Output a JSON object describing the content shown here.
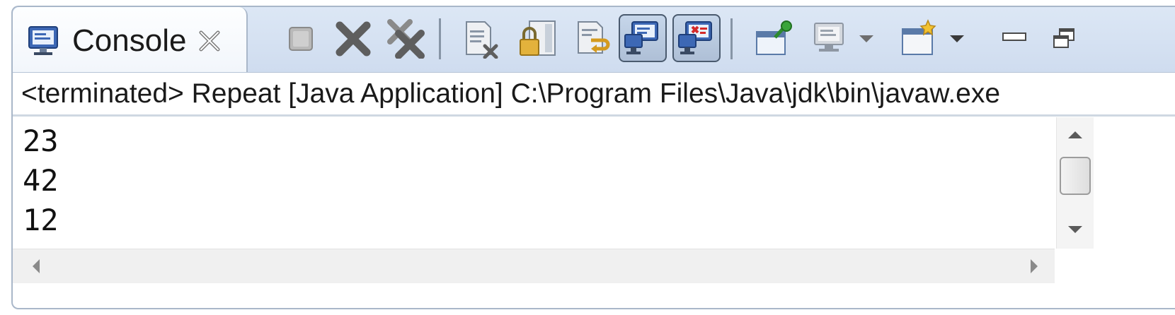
{
  "tab": {
    "label": "Console",
    "icon": "console-monitor-icon",
    "close_icon": "close-icon"
  },
  "toolbar": {
    "items": [
      {
        "name": "terminate",
        "icon": "terminate-stop-icon"
      },
      {
        "name": "remove-launch",
        "icon": "remove-launch-icon"
      },
      {
        "name": "remove-all-terminated",
        "icon": "remove-all-icon"
      },
      {
        "name": "clear-console",
        "icon": "clear-console-icon"
      },
      {
        "name": "scroll-lock",
        "icon": "scroll-lock-icon"
      },
      {
        "name": "word-wrap",
        "icon": "word-wrap-icon"
      },
      {
        "name": "show-on-stdout",
        "icon": "show-console-stdout-icon"
      },
      {
        "name": "show-on-stderr",
        "icon": "show-console-stderr-icon"
      },
      {
        "name": "pin-console",
        "icon": "pin-icon"
      },
      {
        "name": "display-selected-console",
        "icon": "display-console-icon"
      },
      {
        "name": "open-console",
        "icon": "open-console-icon"
      },
      {
        "name": "minimize",
        "icon": "minimize-icon"
      },
      {
        "name": "restore",
        "icon": "restore-icon"
      }
    ]
  },
  "status": {
    "text": "<terminated> Repeat [Java Application] C:\\Program Files\\Java\\jdk\\bin\\javaw.exe"
  },
  "output": {
    "lines": [
      "23",
      "42",
      "12"
    ]
  },
  "colors": {
    "tab_bar": "#d6e2f2",
    "border": "#a9b7c9",
    "toolbar_pressed": "#b6c7de"
  }
}
